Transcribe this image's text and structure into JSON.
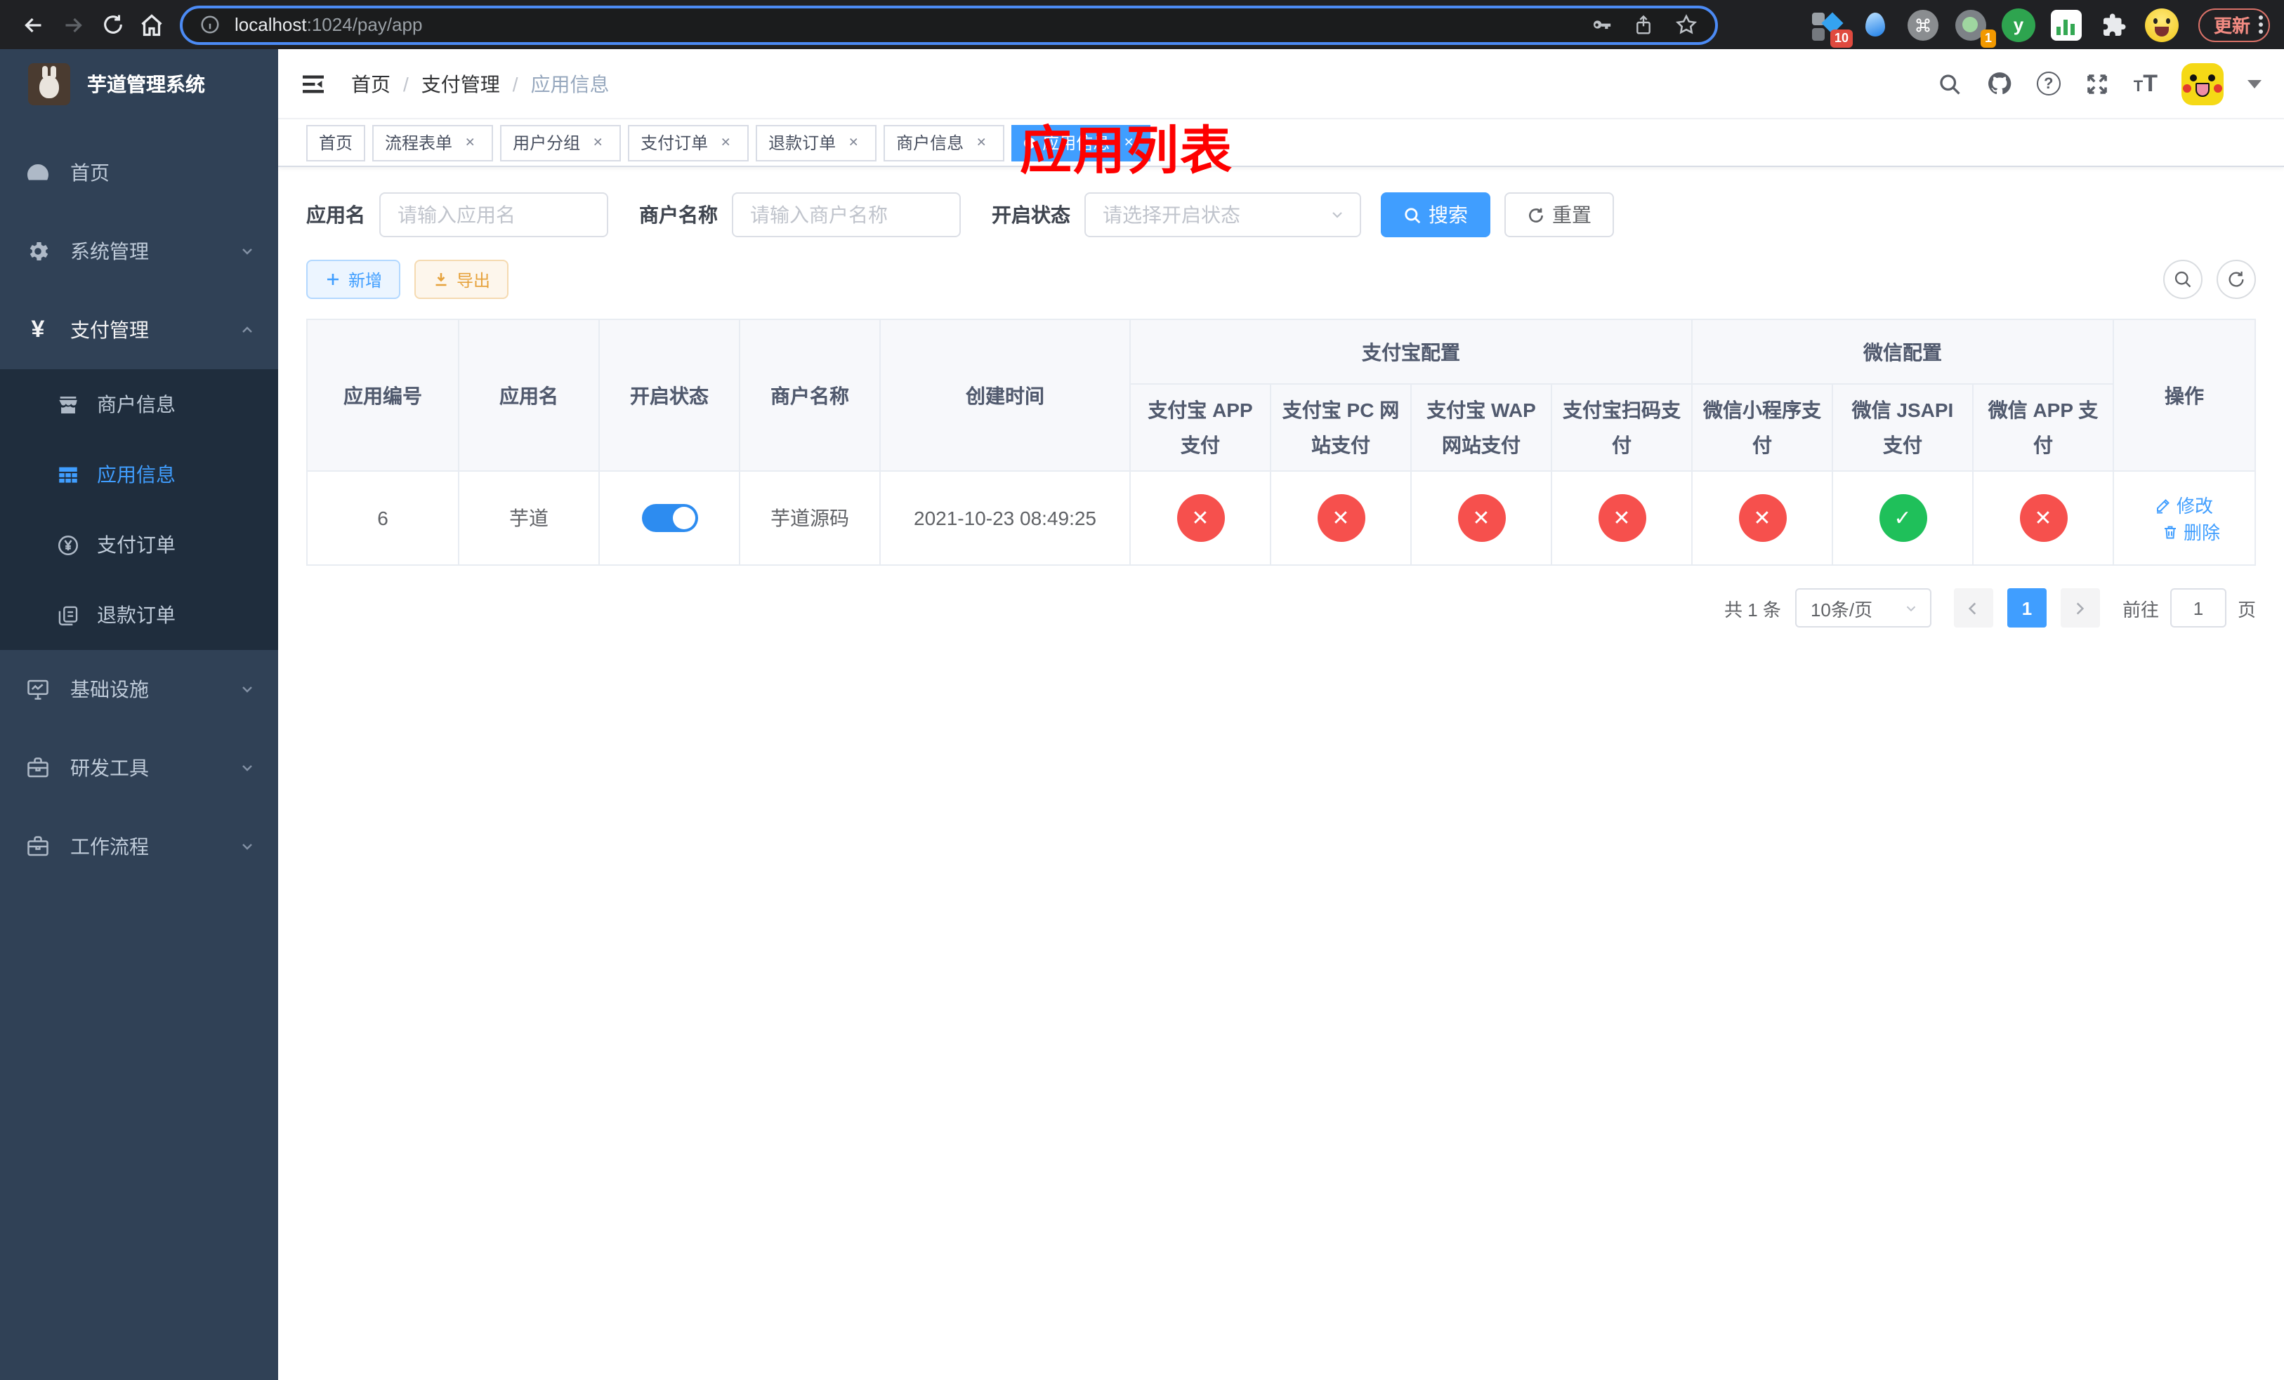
{
  "browser": {
    "url_host": "localhost",
    "url_path": ":1024/pay/app",
    "update_label": "更新",
    "ext_badge_1": "10",
    "ext_badge_2": "1",
    "ext_yuque_letter": "y"
  },
  "sidebar": {
    "title": "芋道管理系统",
    "menu_top": [
      {
        "label": "首页"
      },
      {
        "label": "系统管理"
      },
      {
        "label": "支付管理"
      }
    ],
    "submenu": [
      {
        "label": "商户信息"
      },
      {
        "label": "应用信息"
      },
      {
        "label": "支付订单"
      },
      {
        "label": "退款订单"
      }
    ],
    "menu_bottom": [
      {
        "label": "基础设施"
      },
      {
        "label": "研发工具"
      },
      {
        "label": "工作流程"
      }
    ]
  },
  "navbar": {
    "breadcrumb": [
      {
        "label": "首页"
      },
      {
        "label": "支付管理"
      },
      {
        "label": "应用信息"
      }
    ],
    "separator": "/"
  },
  "annotation": "应用列表",
  "tags": [
    {
      "label": "首页"
    },
    {
      "label": "流程表单"
    },
    {
      "label": "用户分组"
    },
    {
      "label": "支付订单"
    },
    {
      "label": "退款订单"
    },
    {
      "label": "商户信息"
    },
    {
      "label": "应用信息"
    }
  ],
  "filters": {
    "app_name_label": "应用名",
    "app_name_placeholder": "请输入应用名",
    "merchant_label": "商户名称",
    "merchant_placeholder": "请输入商户名称",
    "status_label": "开启状态",
    "status_placeholder": "请选择开启状态",
    "search_label": "搜索",
    "reset_label": "重置"
  },
  "toolbar": {
    "add_label": "新增",
    "export_label": "导出"
  },
  "table": {
    "col_app_id": "应用编号",
    "col_app_name": "应用名",
    "col_status": "开启状态",
    "col_merchant": "商户名称",
    "col_created": "创建时间",
    "col_actions": "操作",
    "group_alipay": "支付宝配置",
    "group_wechat": "微信配置",
    "pay_cols": [
      "支付宝 APP 支付",
      "支付宝 PC 网站支付",
      "支付宝 WAP 网站支付",
      "支付宝扫码支付",
      "微信小程序支付",
      "微信 JSAPI 支付",
      "微信 APP 支付"
    ],
    "row": {
      "id": "6",
      "name": "芋道",
      "enabled": "true",
      "merchant": "芋道源码",
      "created": "2021-10-23 08:49:25",
      "payments": [
        "disabled",
        "disabled",
        "disabled",
        "disabled",
        "disabled",
        "enabled",
        "disabled"
      ],
      "edit_label": "修改",
      "delete_label": "删除"
    }
  },
  "pagination": {
    "total": "共 1 条",
    "page_size": "10条/页",
    "page": "1",
    "goto_label": "前往",
    "goto_value": "1",
    "page_suffix": "页"
  }
}
